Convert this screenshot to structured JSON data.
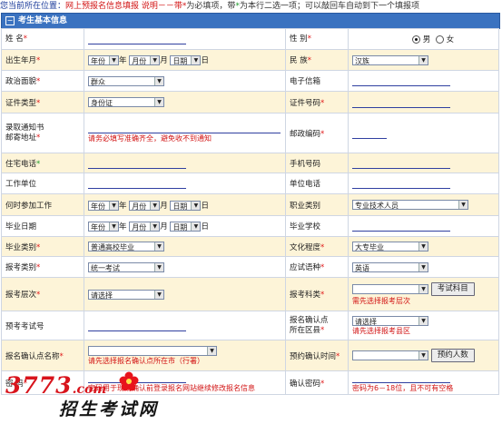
{
  "topbar": {
    "location_label": "您当前所在位置：",
    "breadcrumb": "网上预报名信息填报",
    "note_label": "说明－－带",
    "note_required_mark": "*",
    "note_required_text": "为必填项，带",
    "note_either_mark": "*",
    "note_either_text": "为本行二选一项；可以敲回车自动到下一个填报项"
  },
  "section": {
    "title": "考生基本信息"
  },
  "rows": {
    "name": {
      "label": "姓  名"
    },
    "gender": {
      "label": "性  别",
      "male": "男",
      "female": "女"
    },
    "birth": {
      "label": "出生年月",
      "year": "年份",
      "year_unit": "年",
      "month": "月份",
      "month_unit": "月",
      "day": "日期",
      "day_unit": "日"
    },
    "ethnicity": {
      "label": "民  族",
      "value": "汉族"
    },
    "political": {
      "label": "政治面貌",
      "value": "群众"
    },
    "email": {
      "label": "电子信箱"
    },
    "id_type": {
      "label": "证件类型",
      "value": "身份证"
    },
    "id_number": {
      "label": "证件号码"
    },
    "address": {
      "label_line1": "录取通知书",
      "label_line2": "邮寄地址",
      "hint": "请务必填写准确齐全，避免收不到通知"
    },
    "postcode": {
      "label": "邮政编码"
    },
    "home_phone": {
      "label": "住宅电话"
    },
    "mobile": {
      "label": "手机号码"
    },
    "work_unit": {
      "label": "工作单位"
    },
    "work_phone": {
      "label": "单位电话"
    },
    "work_start": {
      "label": "何时参加工作",
      "year": "年份",
      "year_unit": "年",
      "month": "月份",
      "month_unit": "月",
      "day": "日期",
      "day_unit": "日"
    },
    "job_category": {
      "label": "职业类别",
      "value": "专业技术人员"
    },
    "grad_date": {
      "label": "毕业日期",
      "year": "年份",
      "year_unit": "年",
      "month": "月份",
      "month_unit": "月",
      "day": "日期",
      "day_unit": "日"
    },
    "grad_school": {
      "label": "毕业学校"
    },
    "grad_category": {
      "label": "毕业类别",
      "value": "普通高校毕业"
    },
    "education": {
      "label": "文化程度",
      "value": "大专毕业"
    },
    "exam_category": {
      "label": "报考类别",
      "value": "统一考试"
    },
    "exam_language": {
      "label": "应试语种",
      "value": "英语"
    },
    "exam_level": {
      "label": "报考层次",
      "value": "请选择"
    },
    "exam_subject": {
      "label": "报考科类",
      "button": "考试科目",
      "hint": "需先选择报考层次"
    },
    "pre_exam_no": {
      "label": "预考考试号"
    },
    "confirm_district": {
      "label_line1": "报名确认点",
      "label_line2": "所在区县",
      "value": "请选择",
      "hint": "请先选择报考县区"
    },
    "confirm_point": {
      "label": "报名确认点名称",
      "hint": "请先选择报名确认点所在市（行署）"
    },
    "appointment": {
      "label": "预约确认时间",
      "button": "预约人数"
    },
    "password": {
      "label": "密  码",
      "hint": "密码用于现场确认前登录报名网站继续修改报名信息"
    },
    "confirm_password": {
      "label": "确认密码",
      "hint": "密码为6－18位，且不可有空格"
    }
  },
  "watermark": {
    "number": "3773",
    "domain": ".com",
    "tagline": "招生考试网"
  },
  "colors": {
    "header_bg": "#3a72c0",
    "row_alt": "#fdf4d8",
    "required": "#e01818",
    "hint": "#d21414",
    "link": "#1a3a9a"
  }
}
